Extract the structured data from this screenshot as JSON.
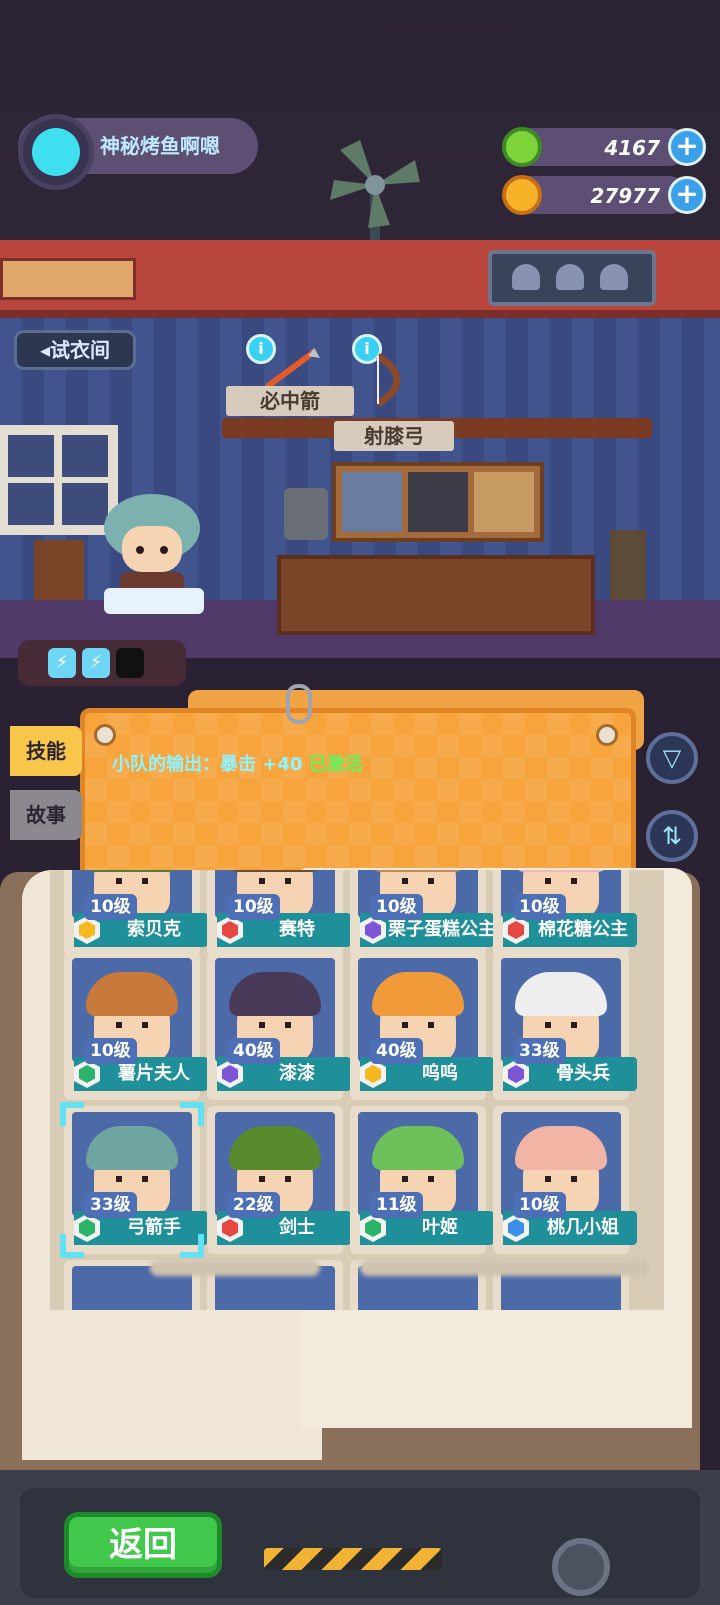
{
  "player": {
    "name": "神秘烤鱼啊嗯"
  },
  "currencies": [
    {
      "id": "green-gem",
      "value": "4167",
      "color": "#7ed33b"
    },
    {
      "id": "gold-coin",
      "value": "27977",
      "color": "#f7b22a"
    }
  ],
  "room": {
    "try_button": "◂试衣间",
    "items": [
      {
        "label": "必中箭"
      },
      {
        "label": "射膝弓"
      }
    ],
    "energy_count": 2
  },
  "panel": {
    "skill_prefix": "小队的输出：暴击 +40",
    "skill_status": "已激活",
    "tabs": {
      "skills": "技能",
      "story": "故事"
    }
  },
  "characters": [
    {
      "level": "10级",
      "name": "索贝克",
      "badge_color": "#f5b81f",
      "art_color": "#4e7d45"
    },
    {
      "level": "10级",
      "name": "赛特",
      "badge_color": "#e44840",
      "art_color": "#6b4a3a"
    },
    {
      "level": "10级",
      "name": "栗子蛋糕公主",
      "badge_color": "#7d56d6",
      "art_color": "#c48a5c"
    },
    {
      "level": "10级",
      "name": "棉花糖公主",
      "badge_color": "#e44840",
      "art_color": "#f1b7bf"
    },
    {
      "level": "10级",
      "name": "薯片夫人",
      "badge_color": "#2bb36a",
      "art_color": "#c77a3c"
    },
    {
      "level": "40级",
      "name": "漆漆",
      "badge_color": "#7d56d6",
      "art_color": "#4a3a5a"
    },
    {
      "level": "40级",
      "name": "呜呜",
      "badge_color": "#f5b81f",
      "art_color": "#f09a3a"
    },
    {
      "level": "33级",
      "name": "骨头兵",
      "badge_color": "#7d56d6",
      "art_color": "#eeeeee"
    },
    {
      "level": "33级",
      "name": "弓箭手",
      "badge_color": "#2bb36a",
      "art_color": "#6fa6a2",
      "selected": true
    },
    {
      "level": "22级",
      "name": "剑士",
      "badge_color": "#e44840",
      "art_color": "#5a8a2e"
    },
    {
      "level": "11级",
      "name": "叶姬",
      "badge_color": "#2bb36a",
      "art_color": "#6ec15a"
    },
    {
      "level": "10级",
      "name": "桃几小姐",
      "badge_color": "#3a8ee8",
      "art_color": "#f2b5a5"
    }
  ],
  "bottom": {
    "back_button": "返回"
  }
}
